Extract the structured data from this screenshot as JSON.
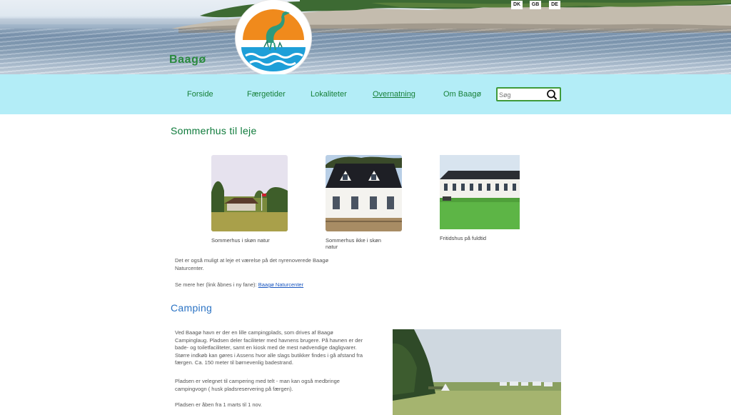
{
  "header": {
    "brand": "Baagø",
    "languages": [
      "DK",
      "GB",
      "DE"
    ]
  },
  "nav": {
    "items": [
      {
        "label": "Forside"
      },
      {
        "label": "Færgetider"
      },
      {
        "label": "Lokaliteter"
      },
      {
        "label": "Overnatning",
        "active": true
      },
      {
        "label": "Om Baagø"
      }
    ],
    "search_placeholder": "Søg"
  },
  "sections": {
    "sommerhus": {
      "title": "Sommerhus til leje",
      "gallery": [
        {
          "caption": "Sommerhus i skøn natur"
        },
        {
          "caption": "Sommerhus ikke i skøn natur"
        },
        {
          "caption": "Fritidshus på fuldtid"
        }
      ],
      "intro": "Det er også muligt at leje et værelse på det nyrenoverede Baagø Naturcenter.",
      "more_prefix": "Se mere her (link åbnes i ny fane): ",
      "more_link": "Baagø Naturcenter"
    },
    "camping": {
      "title": "Camping",
      "p1": "Ved Baagø havn er der en lille campingplads, som drives af Baagø Campinglaug. Pladsen deler faciliteter med havnens brugere. På havnen er der bade- og toiletfaciliteter, samt en kiosk med de mest nødvendige dagligvarer. Større indkøb kan gøres i Assens hvor alle slags butikker findes i gå afstand fra færgen. Ca. 150 meter til børnevenlig badestrand.",
      "p2": "Pladsen er velegnet til campering med telt -  man kan også medbringe campingvogn ( husk pladsreservering på færgen).",
      "p3": "Pladsen er åben fra 1 marts til 1 nov."
    }
  },
  "colors": {
    "nav_bg": "#b3edf7",
    "nav_text": "#178039",
    "heading_green": "#0d7a3a",
    "heading_blue": "#2b73c4",
    "logo_orange": "#f08a1c",
    "logo_blue": "#1e9fd8",
    "logo_bird": "#2e9a7c"
  },
  "icons": {
    "search": "search-icon",
    "logo": "heron-logo"
  }
}
